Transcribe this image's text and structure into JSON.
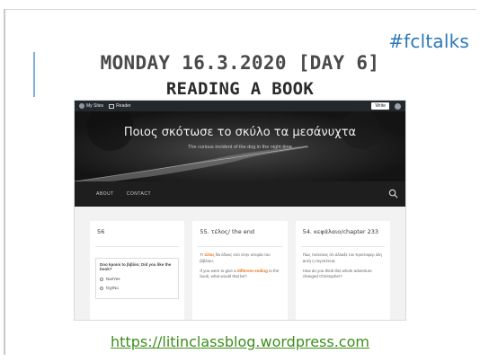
{
  "slide": {
    "hashtag": "#fcltalks",
    "title_line1": "MONDAY 16.3.2020  [DAY 6]",
    "title_line2": "READING A BOOK",
    "link_url": "https://litinclassblog.wordpress.com"
  },
  "screenshot": {
    "wp_bar": {
      "my_sites": "My Sites",
      "reader": "Reader",
      "write": "Write"
    },
    "header": {
      "blog_title": "Ποιος σκότωσε το σκύλο τα μεσάνυχτα",
      "subtitle": "The curious incident of the dog in the night-time"
    },
    "nav": {
      "items": [
        "ABOUT",
        "CONTACT"
      ]
    },
    "posts": [
      {
        "title": "56",
        "poll_question": "Doo kpoini to βιβλίο; Did you like the book?",
        "poll_options": [
          "Ναι/Yes",
          "Όχι/No"
        ]
      },
      {
        "title": "55. τέλος/ the end",
        "line1_pre": "Τι ",
        "line1_hl": "τέλος",
        "line1_post": " θα έδινες εσύ στην ιστορία του βιβλίου;",
        "line2_pre": "If you were to give a ",
        "line2_hl": "different ending",
        "line2_post": " to the book, what would that be?"
      },
      {
        "title": "54. κεφάλαιο/chapter 233",
        "line1": "Πώς πιστεύεις ότι άλλαξε τον Κριστοφερ όλη αυτή η περιπέτεια;",
        "line2": "How do you think this whole adventure changed Christopher?"
      }
    ]
  },
  "colors": {
    "hashtag": "#2b78b7",
    "link": "#3e8e1c",
    "highlight": "#e8711a"
  }
}
